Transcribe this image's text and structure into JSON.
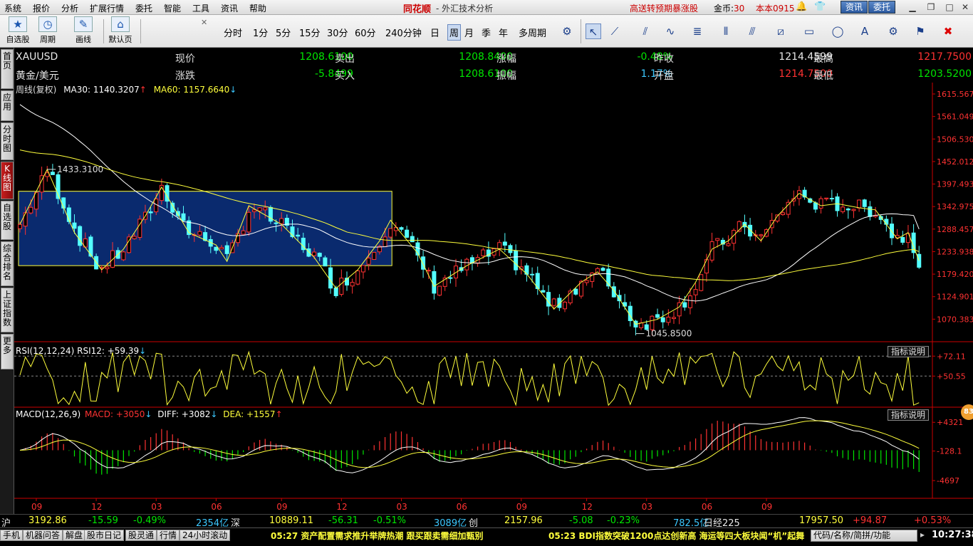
{
  "menubar": {
    "items": [
      "系统",
      "报价",
      "分析",
      "扩展行情",
      "委托",
      "智能",
      "工具",
      "资讯",
      "帮助"
    ],
    "brand": "同花顺",
    "title": "- 外汇技术分析",
    "promo": "高送转预期暴涨股",
    "coins_label": "金币:",
    "coins_value": "30",
    "user": "本本0915",
    "btn_news": "资讯",
    "btn_trade": "委托"
  },
  "toolbar": {
    "big_buttons": [
      {
        "label": "自选股",
        "icon": "star-icon"
      },
      {
        "label": "周期",
        "icon": "clock-icon"
      },
      {
        "label": "画线",
        "icon": "pencil-icon"
      },
      {
        "label": "默认页",
        "icon": "home-icon"
      }
    ],
    "periods": [
      "分时",
      "1分",
      "5分",
      "15分",
      "30分",
      "60分",
      "240分钟",
      "日",
      "周",
      "月",
      "季",
      "年",
      "多周期"
    ],
    "active_period": "周"
  },
  "left_tabs": [
    {
      "label": "首页"
    },
    {
      "label": "应用"
    },
    {
      "label": "分时图"
    },
    {
      "label": "K线图",
      "active": true
    },
    {
      "label": "自选股"
    },
    {
      "label": "综合排名"
    },
    {
      "label": "上证指数"
    },
    {
      "label": "更多"
    }
  ],
  "quote": {
    "symbol": "XAUUSD",
    "name": "黄金/美元",
    "rows": [
      [
        {
          "label": "现价",
          "value": "1208.6100",
          "color": "green"
        },
        {
          "label": "卖出",
          "value": "1208.8400",
          "color": "green"
        },
        {
          "label": "涨幅",
          "value": "-0.48%",
          "color": "green"
        },
        {
          "label": "昨收",
          "value": "1214.4599",
          "color": "white"
        },
        {
          "label": "最高",
          "value": "1217.7500",
          "color": "red"
        }
      ],
      [
        {
          "label": "涨跌",
          "value": "-5.8499",
          "color": "green"
        },
        {
          "label": "买入",
          "value": "1208.6100",
          "color": "green"
        },
        {
          "label": "振幅",
          "value": "1.17%",
          "color": "cyan"
        },
        {
          "label": "开盘",
          "value": "1214.7500",
          "color": "red"
        },
        {
          "label": "最低",
          "value": "1203.5200",
          "color": "green"
        }
      ]
    ]
  },
  "main_legend": {
    "label": "周线(复权)",
    "ma30": "MA30: 1140.3207",
    "ma60": "MA60: 1157.6640"
  },
  "rsi_legend": "RSI(12,12,24)  RSI12: +59.39",
  "macd_legend": {
    "name": "MACD(12,26,9)",
    "macd": "MACD: +3050",
    "diff": "DIFF: +3082",
    "dea": "DEA: +1557"
  },
  "indicator_button": "指标说明",
  "annotations": {
    "high": "1433.3100",
    "low": "1045.8500"
  },
  "badge": "83",
  "chart_data": [
    {
      "type": "candlestick",
      "title": "周线(复权)",
      "yticks": [
        "1615.5679",
        "1561.0490",
        "1506.5301",
        "1452.0123",
        "1397.4933",
        "1342.9754",
        "1288.4570",
        "1233.9385",
        "1179.4201",
        "1124.9017",
        "1070.3833"
      ],
      "ylim": [
        1015.86,
        1615.57
      ],
      "xticks": [
        {
          "label": "09",
          "x": 3
        },
        {
          "label": "12",
          "x": 16
        },
        {
          "label": "03",
          "x": 29
        },
        {
          "label": "06",
          "x": 42
        },
        {
          "label": "09",
          "x": 55
        },
        {
          "label": "12",
          "x": 68
        },
        {
          "label": "03",
          "x": 81
        },
        {
          "label": "06",
          "x": 94
        },
        {
          "label": "09",
          "x": 107
        },
        {
          "label": "12",
          "x": 120
        },
        {
          "label": "03",
          "x": 133
        },
        {
          "label": "06",
          "x": 146
        },
        {
          "label": "09",
          "x": 159
        }
      ],
      "series_ma30_start": 1590,
      "series_ma60_start": 1480,
      "ma30_end": 1288.46,
      "ma60_end": 1233.94
    },
    {
      "type": "line",
      "name": "RSI12",
      "yticks": [
        "+72.11",
        "+50.55"
      ],
      "ylim": [
        20,
        80
      ]
    },
    {
      "type": "bar",
      "name": "MACD",
      "yticks": [
        "+4321",
        "-128.1",
        "-4697"
      ],
      "ylim": [
        -7000,
        6000
      ]
    }
  ],
  "index_bar": [
    {
      "text": "沪",
      "color": "white"
    },
    {
      "text": "3192.86",
      "color": "yellow"
    },
    {
      "text": "-15.59",
      "color": "green"
    },
    {
      "text": "-0.49%",
      "color": "green"
    },
    {
      "text": "2354亿",
      "color": "cyan"
    },
    {
      "text": "深",
      "color": "white"
    },
    {
      "text": "10889.11",
      "color": "yellow"
    },
    {
      "text": "-56.31",
      "color": "green"
    },
    {
      "text": "-0.51%",
      "color": "green"
    },
    {
      "text": "3089亿",
      "color": "cyan"
    },
    {
      "text": "创",
      "color": "white"
    },
    {
      "text": "2157.96",
      "color": "yellow"
    },
    {
      "text": "-5.08",
      "color": "green"
    },
    {
      "text": "-0.23%",
      "color": "green"
    },
    {
      "text": "782.5亿",
      "color": "cyan"
    },
    {
      "text": "日经225",
      "color": "white"
    },
    {
      "text": "17957.50",
      "color": "yellow"
    },
    {
      "text": "+94.87",
      "color": "red"
    },
    {
      "text": "+0.53%",
      "color": "red"
    }
  ],
  "status_tabs": [
    "手机",
    "机器问答",
    "解盘",
    "股市日记",
    "股灵通",
    "行情",
    "24小时滚动"
  ],
  "news": [
    "05:27 资产配置需求推升举牌热潮 跟买跟卖需细加甄别",
    "05:23 BDI指数突破1200点达创新高 海运等四大板块闻“机”起舞"
  ],
  "search_placeholder": "代码/名称/简拼/功能",
  "clock": "10:27:38"
}
